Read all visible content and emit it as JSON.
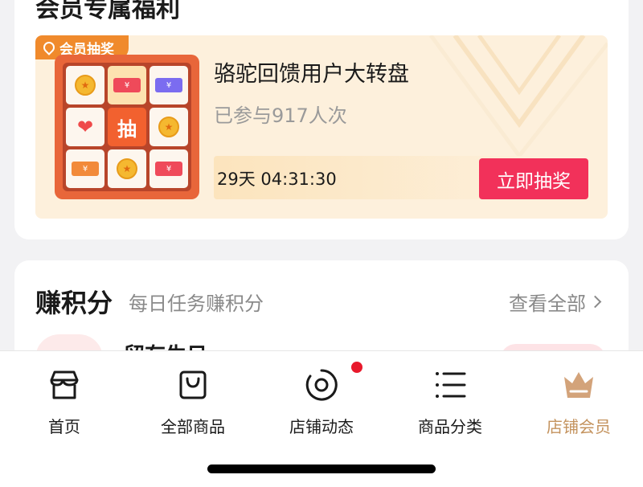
{
  "member": {
    "section_title": "会员专属福利",
    "lottery": {
      "tag": "会员抽奖",
      "title": "骆驼回馈用户大转盘",
      "participants": "已参与917人次",
      "countdown": "29天  04:31:30",
      "center_label": "抽",
      "cta": "立即抽奖"
    }
  },
  "earn": {
    "title": "赚积分",
    "subtitle": "每日任务赚积分",
    "view_all": "查看全部",
    "first_task": "留存生日"
  },
  "tabbar": {
    "tabs": [
      {
        "label": "首页",
        "icon": "storefront-icon"
      },
      {
        "label": "全部商品",
        "icon": "shopping-bag-icon"
      },
      {
        "label": "店铺动态",
        "icon": "camera-lens-icon"
      },
      {
        "label": "商品分类",
        "icon": "list-icon"
      },
      {
        "label": "店铺会员",
        "icon": "crown-icon"
      }
    ],
    "active_index": 4
  },
  "colors": {
    "accent_red": "#f2315a",
    "member_gold": "#c4935e",
    "lottery_orange": "#f08a2c"
  }
}
